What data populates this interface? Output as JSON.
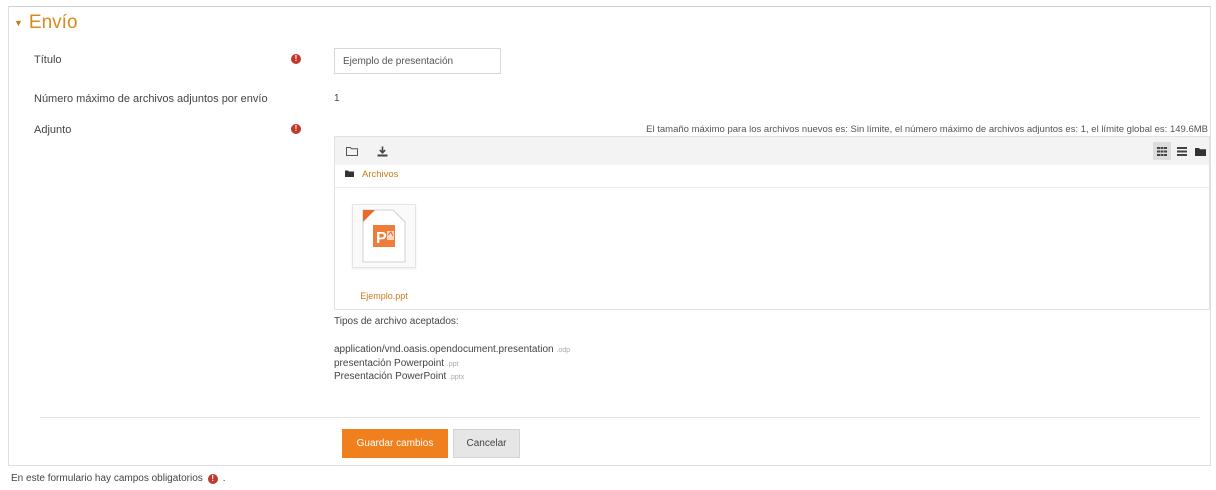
{
  "section": {
    "title": "Envío"
  },
  "fields": {
    "title_label": "Título",
    "title_value": "Ejemplo de presentación",
    "max_files_label": "Número máximo de archivos adjuntos por envío",
    "max_files_value": "1",
    "attachment_label": "Adjunto"
  },
  "required_mark": "!",
  "filepicker": {
    "limits_text": "El tamaño máximo para los archivos nuevos es: Sin límite, el número máximo de archivos adjuntos es: 1, el límite global es: 149.6MB",
    "breadcrumb": "Archivos",
    "file_name": "Ejemplo.ppt",
    "icons": [
      "folder-add-icon",
      "download-icon",
      "grid-view-icon",
      "list-view-icon",
      "tree-view-icon"
    ]
  },
  "accepted": {
    "heading": "Tipos de archivo aceptados:",
    "types": [
      {
        "name": "application/vnd.oasis.opendocument.presentation",
        "ext": ".odp"
      },
      {
        "name": "presentación Powerpoint",
        "ext": ".ppt"
      },
      {
        "name": "Presentación PowerPoint",
        "ext": ".pptx"
      }
    ]
  },
  "buttons": {
    "save": "Guardar cambios",
    "cancel": "Cancelar"
  },
  "footer": {
    "text": "En este formulario hay campos obligatorios",
    "suffix": "."
  },
  "colors": {
    "accent": "#f0801e",
    "link": "#c97a1c",
    "required": "#c0392b"
  }
}
